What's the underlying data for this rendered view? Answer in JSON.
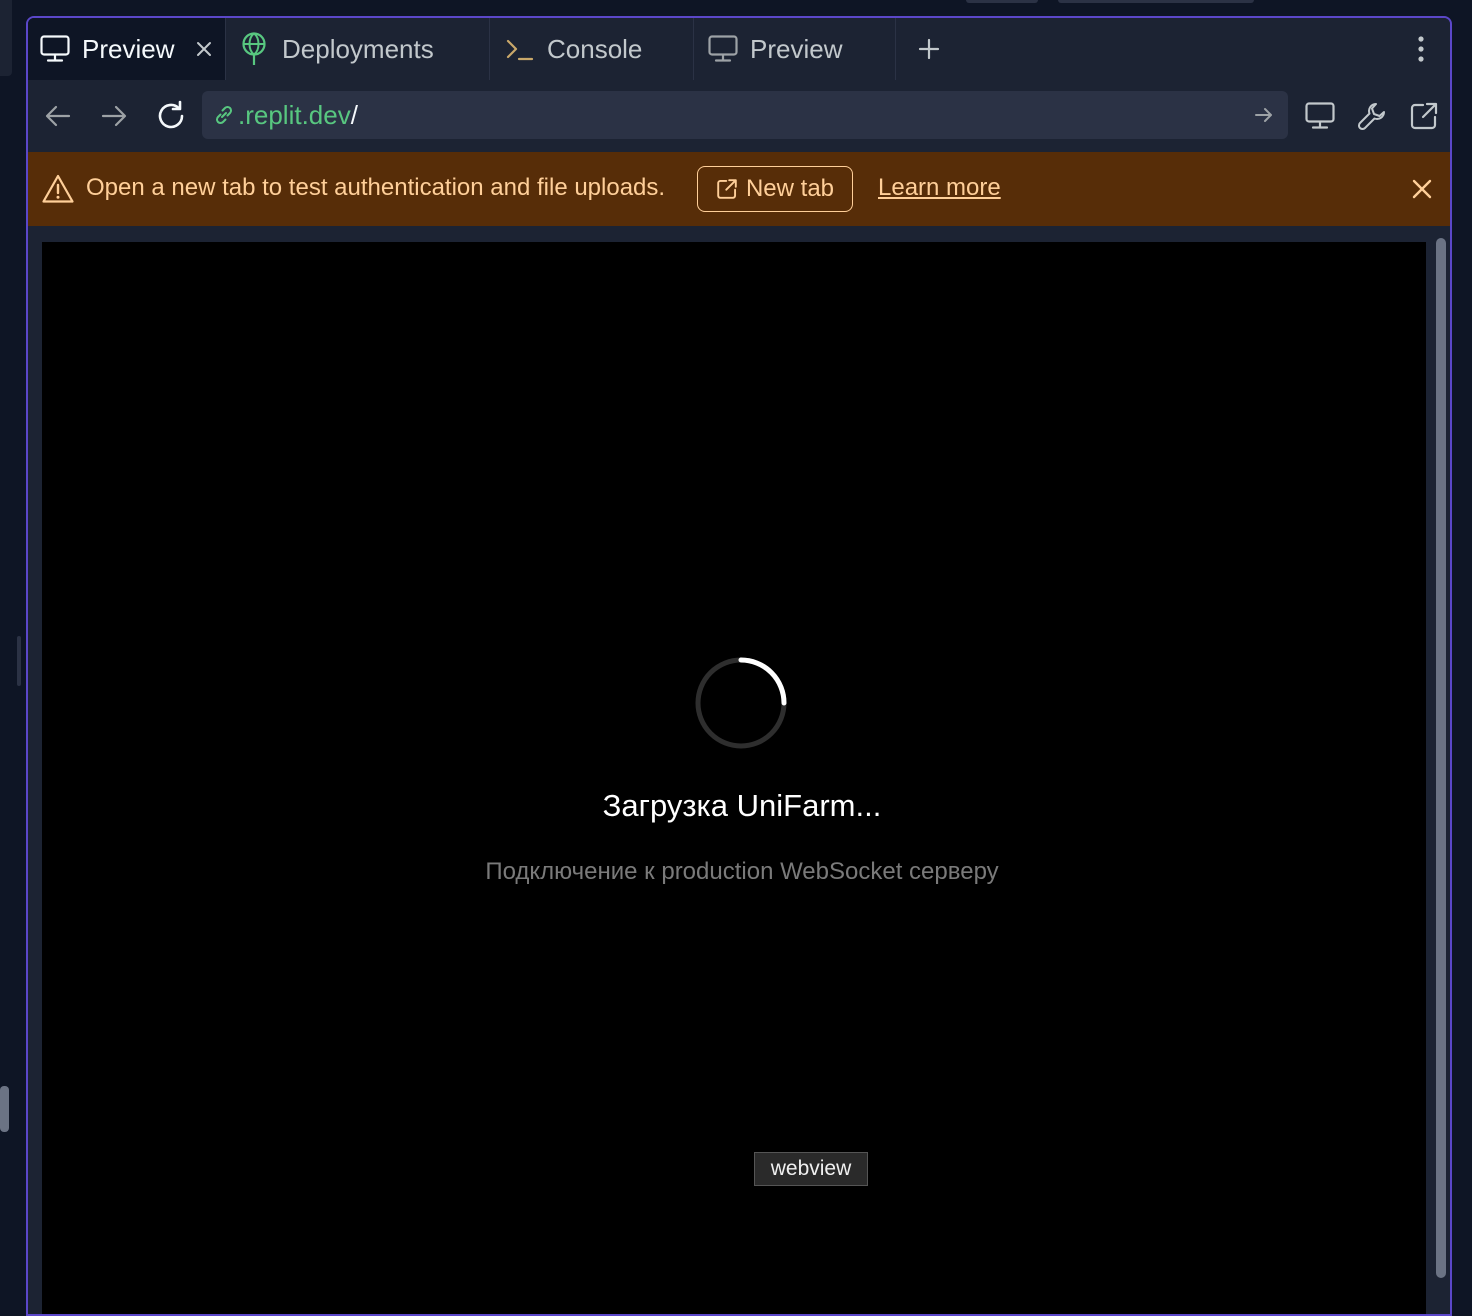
{
  "tabs": [
    {
      "label": "Preview",
      "icon": "monitor-icon",
      "active": true
    },
    {
      "label": "Deployments",
      "icon": "deployments-icon",
      "active": false
    },
    {
      "label": "Console",
      "icon": "terminal-icon",
      "active": false
    },
    {
      "label": "Preview",
      "icon": "monitor-icon",
      "active": false
    }
  ],
  "url": {
    "host": ".replit.dev",
    "path": "/"
  },
  "banner": {
    "message": "Open a new tab to test authentication and file uploads.",
    "new_tab_label": "New tab",
    "learn_more_label": "Learn more"
  },
  "webview": {
    "title": "Загрузка UniFarm...",
    "subtitle": "Подключение к production WebSocket серверу",
    "tooltip": "webview"
  },
  "colors": {
    "accent_border": "#5b47c9",
    "banner_bg": "#572d08",
    "banner_text": "#ffcf99",
    "url_host": "#58c780",
    "deployments_icon": "#58c780",
    "console_icon": "#c9a86a"
  }
}
